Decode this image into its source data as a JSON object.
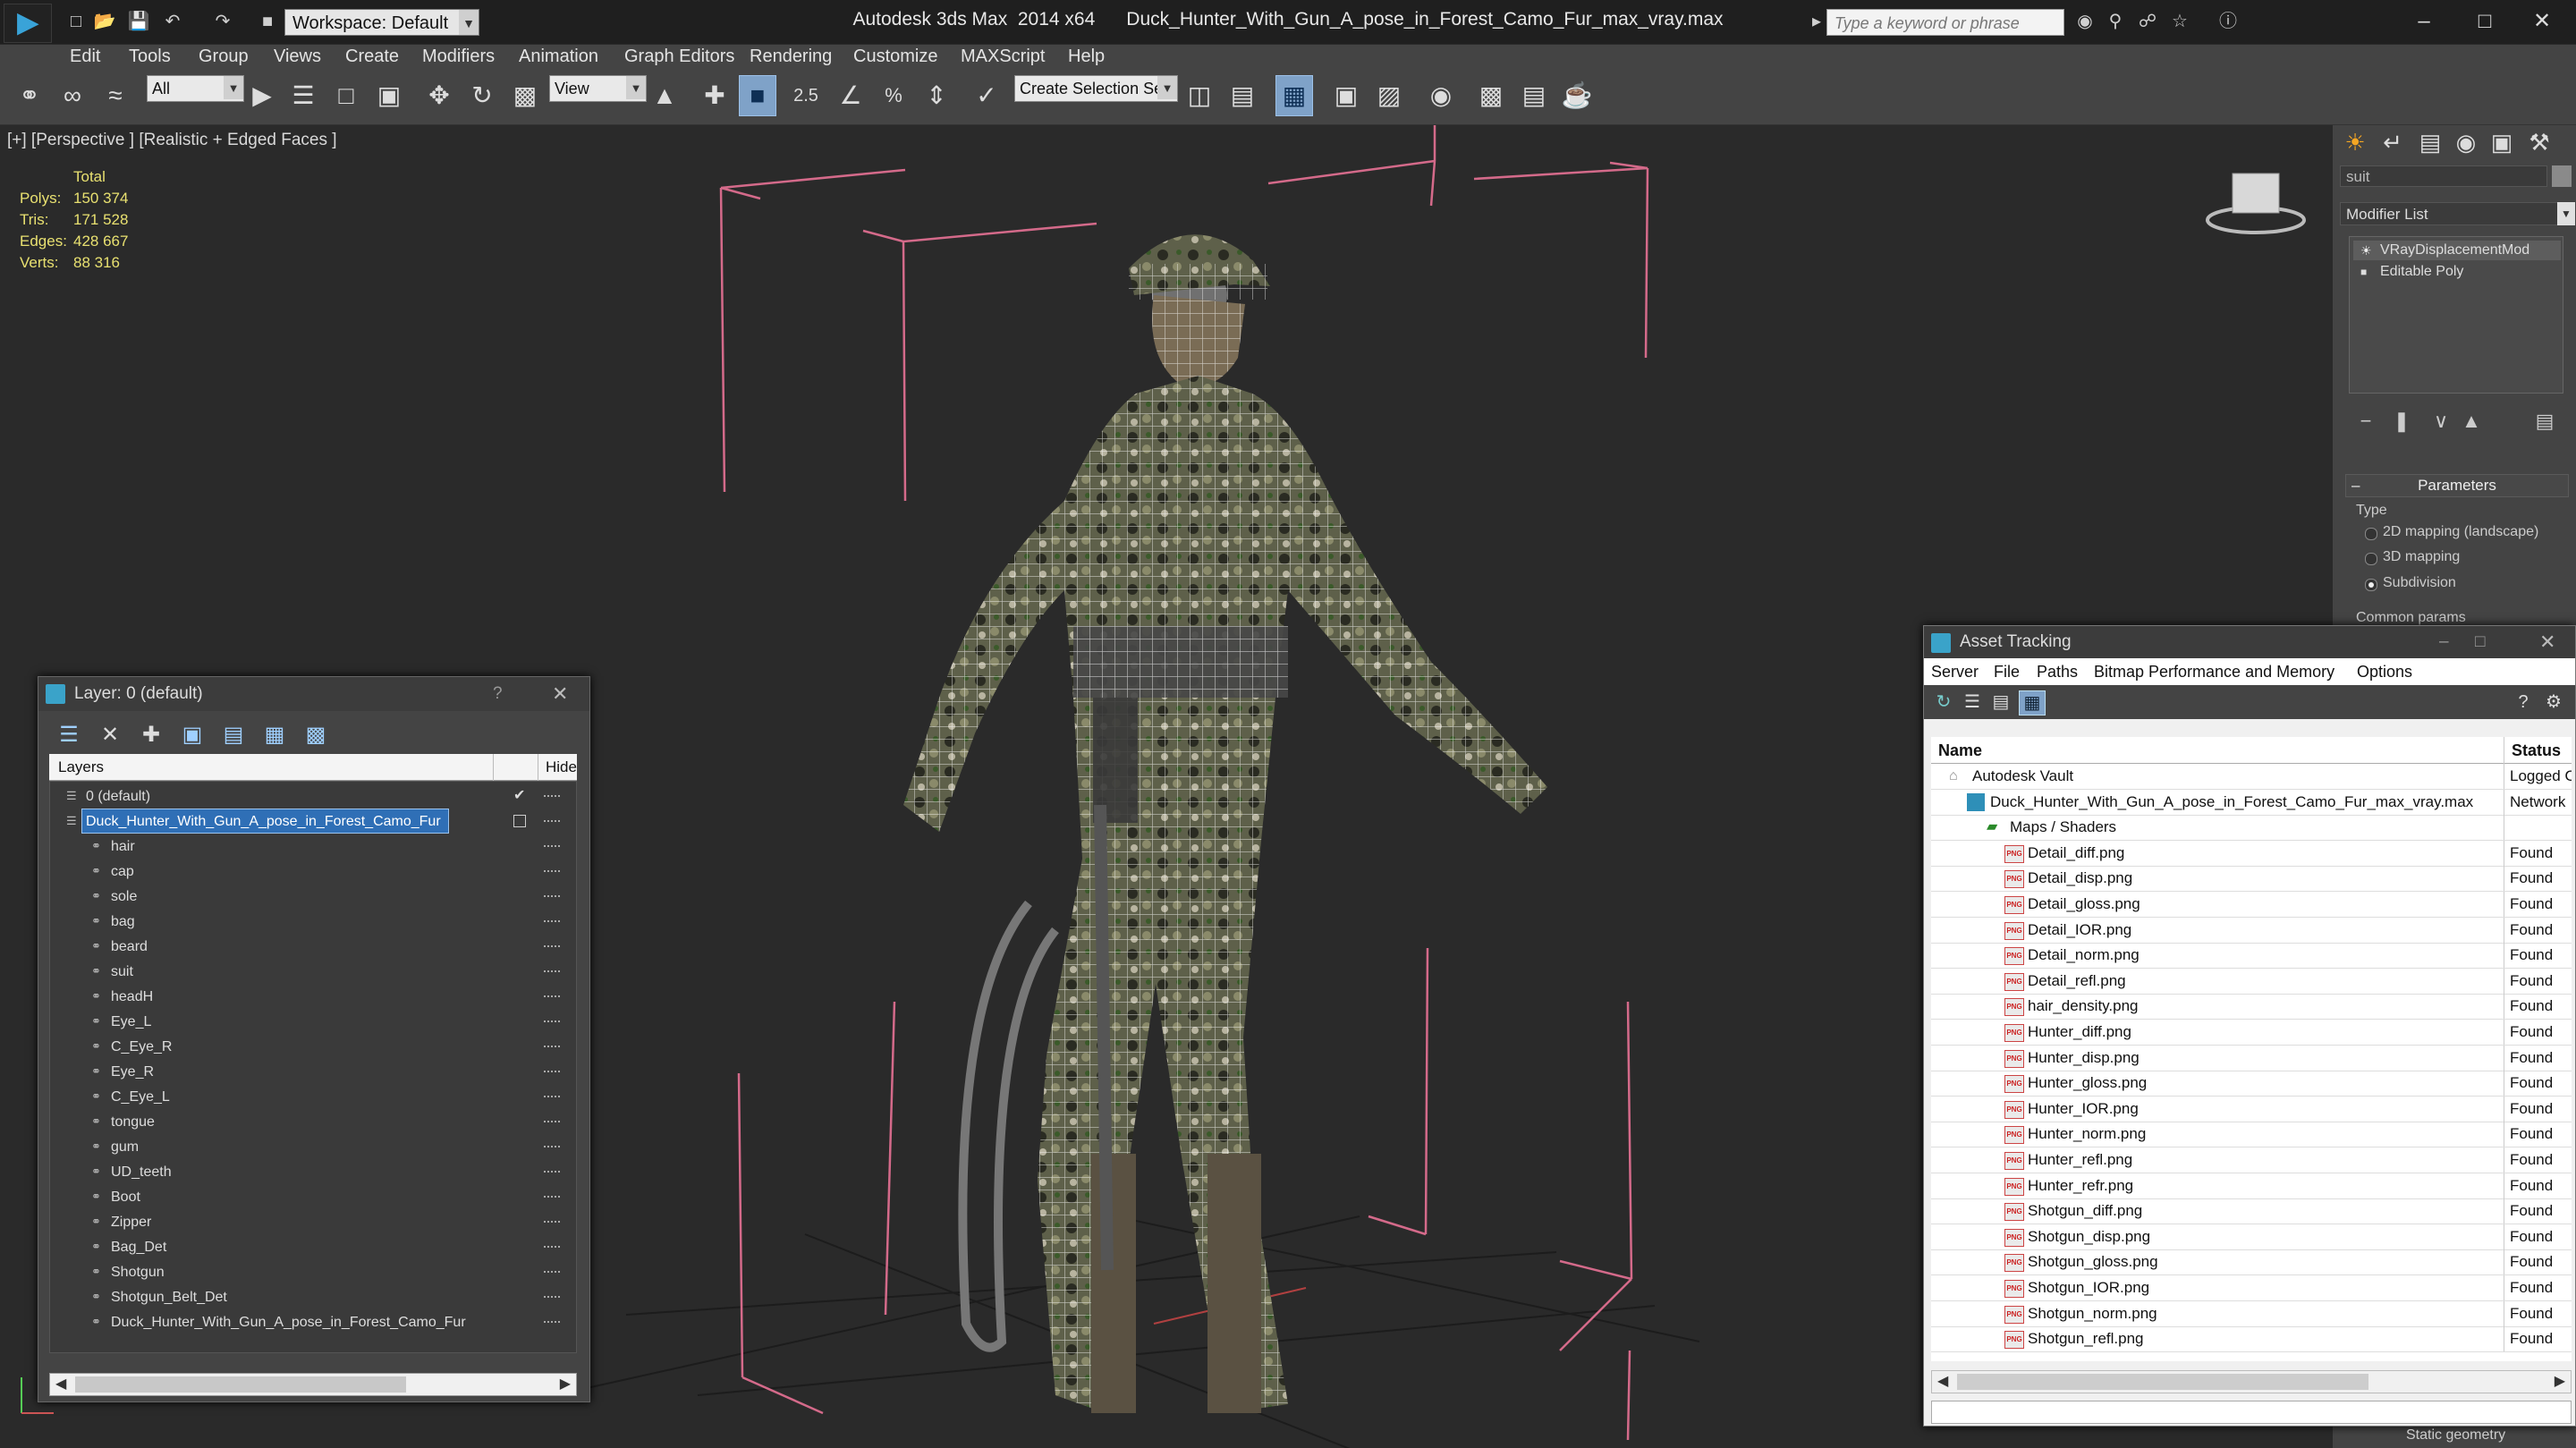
{
  "titlebar": {
    "app": "Autodesk 3ds Max  2014 x64",
    "file": "Duck_Hunter_With_Gun_A_pose_in_Forest_Camo_Fur_max_vray.max",
    "workspace": "Workspace: Default",
    "search_placeholder": "Type a keyword or phrase"
  },
  "menubar": [
    "Edit",
    "Tools",
    "Group",
    "Views",
    "Create",
    "Modifiers",
    "Animation",
    "Graph Editors",
    "Rendering",
    "Customize",
    "MAXScript",
    "Help"
  ],
  "toolbar": {
    "selection_filter": "All",
    "ref_coord": "View",
    "angle_snap": "2.5",
    "named_selection": "Create Selection Se"
  },
  "viewport": {
    "label": "[+] [Perspective ] [Realistic + Edged Faces ]",
    "stats": {
      "header": "Total",
      "rows": [
        {
          "label": "Polys:",
          "value": "150 374"
        },
        {
          "label": "Tris:",
          "value": "171 528"
        },
        {
          "label": "Edges:",
          "value": "428 667"
        },
        {
          "label": "Verts:",
          "value": "88 316"
        }
      ]
    }
  },
  "command_panel": {
    "object_name": "suit",
    "modifier_list": "Modifier List",
    "stack": [
      "VRayDisplacementMod",
      "Editable Poly"
    ],
    "rollout_title": "Parameters",
    "type_label": "Type",
    "options": [
      "2D mapping (landscape)",
      "3D mapping",
      "Subdivision"
    ],
    "selected_option": "Subdivision",
    "common_params": "Common params"
  },
  "layer_dialog": {
    "title": "Layer: 0 (default)",
    "help": "?",
    "col_layers": "Layers",
    "col_hide": "Hide",
    "rows": [
      {
        "name": "0 (default)",
        "level": 0,
        "kind": "layer"
      },
      {
        "name": "Duck_Hunter_With_Gun_A_pose_in_Forest_Camo_Fur",
        "level": 0,
        "kind": "layer",
        "selected": true
      },
      {
        "name": "hair",
        "level": 1,
        "kind": "object"
      },
      {
        "name": "cap",
        "level": 1,
        "kind": "object"
      },
      {
        "name": "sole",
        "level": 1,
        "kind": "object"
      },
      {
        "name": "bag",
        "level": 1,
        "kind": "object"
      },
      {
        "name": "beard",
        "level": 1,
        "kind": "object"
      },
      {
        "name": "suit",
        "level": 1,
        "kind": "object"
      },
      {
        "name": "headH",
        "level": 1,
        "kind": "object"
      },
      {
        "name": "Eye_L",
        "level": 1,
        "kind": "object"
      },
      {
        "name": "C_Eye_R",
        "level": 1,
        "kind": "object"
      },
      {
        "name": "Eye_R",
        "level": 1,
        "kind": "object"
      },
      {
        "name": "C_Eye_L",
        "level": 1,
        "kind": "object"
      },
      {
        "name": "tongue",
        "level": 1,
        "kind": "object"
      },
      {
        "name": "gum",
        "level": 1,
        "kind": "object"
      },
      {
        "name": "UD_teeth",
        "level": 1,
        "kind": "object"
      },
      {
        "name": "Boot",
        "level": 1,
        "kind": "object"
      },
      {
        "name": "Zipper",
        "level": 1,
        "kind": "object"
      },
      {
        "name": "Bag_Det",
        "level": 1,
        "kind": "object"
      },
      {
        "name": "Shotgun",
        "level": 1,
        "kind": "object"
      },
      {
        "name": "Shotgun_Belt_Det",
        "level": 1,
        "kind": "object"
      },
      {
        "name": "Duck_Hunter_With_Gun_A_pose_in_Forest_Camo_Fur",
        "level": 1,
        "kind": "object"
      }
    ]
  },
  "asset_dialog": {
    "title": "Asset Tracking",
    "menu": [
      "Server",
      "File",
      "Paths",
      "Bitmap Performance and Memory",
      "Options"
    ],
    "col_name": "Name",
    "col_status": "Status",
    "rows": [
      {
        "name": "Autodesk Vault",
        "status": "Logged O",
        "level": 0,
        "kind": "vault"
      },
      {
        "name": "Duck_Hunter_With_Gun_A_pose_in_Forest_Camo_Fur_max_vray.max",
        "status": "Network",
        "level": 1,
        "kind": "max"
      },
      {
        "name": "Maps / Shaders",
        "status": "",
        "level": 2,
        "kind": "folder"
      },
      {
        "name": "Detail_diff.png",
        "status": "Found",
        "level": 3,
        "kind": "png"
      },
      {
        "name": "Detail_disp.png",
        "status": "Found",
        "level": 3,
        "kind": "png"
      },
      {
        "name": "Detail_gloss.png",
        "status": "Found",
        "level": 3,
        "kind": "png"
      },
      {
        "name": "Detail_IOR.png",
        "status": "Found",
        "level": 3,
        "kind": "png"
      },
      {
        "name": "Detail_norm.png",
        "status": "Found",
        "level": 3,
        "kind": "png"
      },
      {
        "name": "Detail_refl.png",
        "status": "Found",
        "level": 3,
        "kind": "png"
      },
      {
        "name": "hair_density.png",
        "status": "Found",
        "level": 3,
        "kind": "png"
      },
      {
        "name": "Hunter_diff.png",
        "status": "Found",
        "level": 3,
        "kind": "png"
      },
      {
        "name": "Hunter_disp.png",
        "status": "Found",
        "level": 3,
        "kind": "png"
      },
      {
        "name": "Hunter_gloss.png",
        "status": "Found",
        "level": 3,
        "kind": "png"
      },
      {
        "name": "Hunter_IOR.png",
        "status": "Found",
        "level": 3,
        "kind": "png"
      },
      {
        "name": "Hunter_norm.png",
        "status": "Found",
        "level": 3,
        "kind": "png"
      },
      {
        "name": "Hunter_refl.png",
        "status": "Found",
        "level": 3,
        "kind": "png"
      },
      {
        "name": "Hunter_refr.png",
        "status": "Found",
        "level": 3,
        "kind": "png"
      },
      {
        "name": "Shotgun_diff.png",
        "status": "Found",
        "level": 3,
        "kind": "png"
      },
      {
        "name": "Shotgun_disp.png",
        "status": "Found",
        "level": 3,
        "kind": "png"
      },
      {
        "name": "Shotgun_gloss.png",
        "status": "Found",
        "level": 3,
        "kind": "png"
      },
      {
        "name": "Shotgun_IOR.png",
        "status": "Found",
        "level": 3,
        "kind": "png"
      },
      {
        "name": "Shotgun_norm.png",
        "status": "Found",
        "level": 3,
        "kind": "png"
      },
      {
        "name": "Shotgun_refl.png",
        "status": "Found",
        "level": 3,
        "kind": "png"
      }
    ]
  },
  "statusbar": {
    "right_text": "Static geometry"
  },
  "colors": {
    "accent": "#2f6fb6",
    "stats_yellow": "#e8e070",
    "bbox_pink": "#d46a8a",
    "viewport_bg": "#2a2a2a"
  }
}
